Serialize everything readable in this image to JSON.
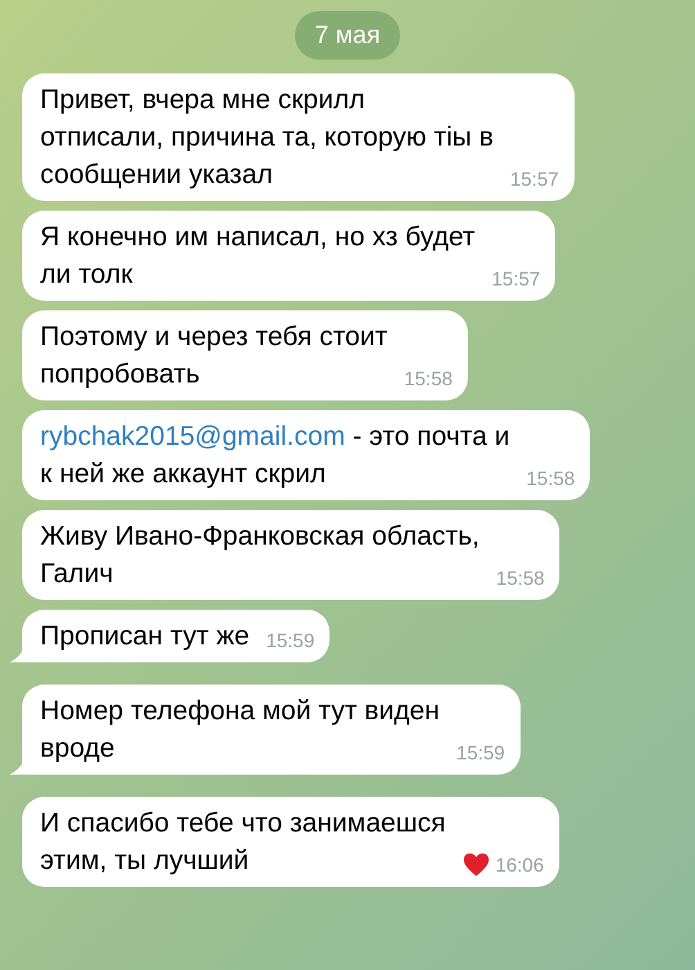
{
  "date_label": "7 мая",
  "messages": [
    {
      "lines": [
        "Привет, вчера мне скрилл",
        "отписали, причина та, которую тiы в",
        "сообщении указал"
      ],
      "time": "15:57",
      "tail": false,
      "liked": false
    },
    {
      "lines": [
        "Я конечно им написал, но хз будет",
        "ли толк"
      ],
      "time": "15:57",
      "tail": false,
      "liked": false
    },
    {
      "lines": [
        "Поэтому и через тебя стоит",
        "попробовать"
      ],
      "time": "15:58",
      "tail": false,
      "liked": false
    },
    {
      "link": "rybchak2015@gmail.com",
      "lines": [
        " - это почта и",
        "к ней же аккаунт скрил"
      ],
      "time": "15:58",
      "tail": false,
      "liked": false
    },
    {
      "lines": [
        "Живу Ивано-Франковская область,",
        "Галич"
      ],
      "time": "15:58",
      "tail": false,
      "liked": false
    },
    {
      "lines": [
        "Прописан тут же"
      ],
      "time": "15:59",
      "tail": true,
      "liked": false
    },
    {
      "lines": [
        "Номер телефона мой тут виден",
        "вроде"
      ],
      "time": "15:59",
      "tail": true,
      "liked": false
    },
    {
      "lines": [
        "И спасибо тебе что занимаешся",
        "этим, ты лучший"
      ],
      "time": "16:06",
      "tail": false,
      "liked": true
    }
  ]
}
